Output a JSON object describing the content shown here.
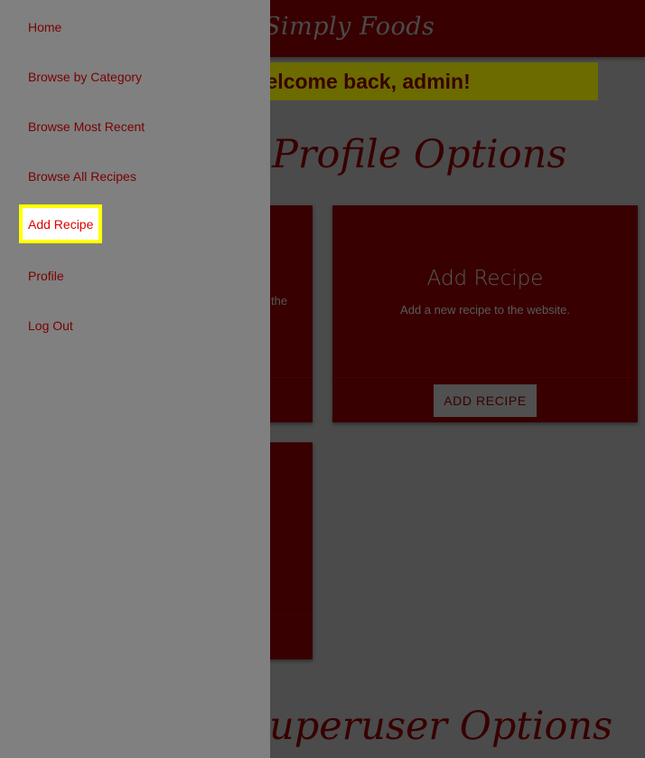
{
  "header": {
    "brand": "Simply Foods"
  },
  "banner": {
    "text": "ul. Welcome back, admin!"
  },
  "sections": {
    "profile_title": "Profile Options",
    "superuser_title": "uperuser Options"
  },
  "cards": {
    "left_partial_text": "the",
    "add_recipe": {
      "title": "Add Recipe",
      "description": "Add a new recipe to the website.",
      "button_label": "ADD RECIPE"
    }
  },
  "sidebar": {
    "items": [
      {
        "label": "Home"
      },
      {
        "label": "Browse by Category"
      },
      {
        "label": "Browse Most Recent"
      },
      {
        "label": "Browse All Recipes"
      },
      {
        "label": "Add Recipe"
      },
      {
        "label": "Profile"
      },
      {
        "label": "Log Out"
      }
    ],
    "active_index": 4
  },
  "colors": {
    "brand_dark_red": "#380000",
    "sidebar_bg": "#808080",
    "sidebar_text": "#7a0000",
    "highlight_border": "#ffff00",
    "overlay_bg": "#4b4b4b"
  }
}
